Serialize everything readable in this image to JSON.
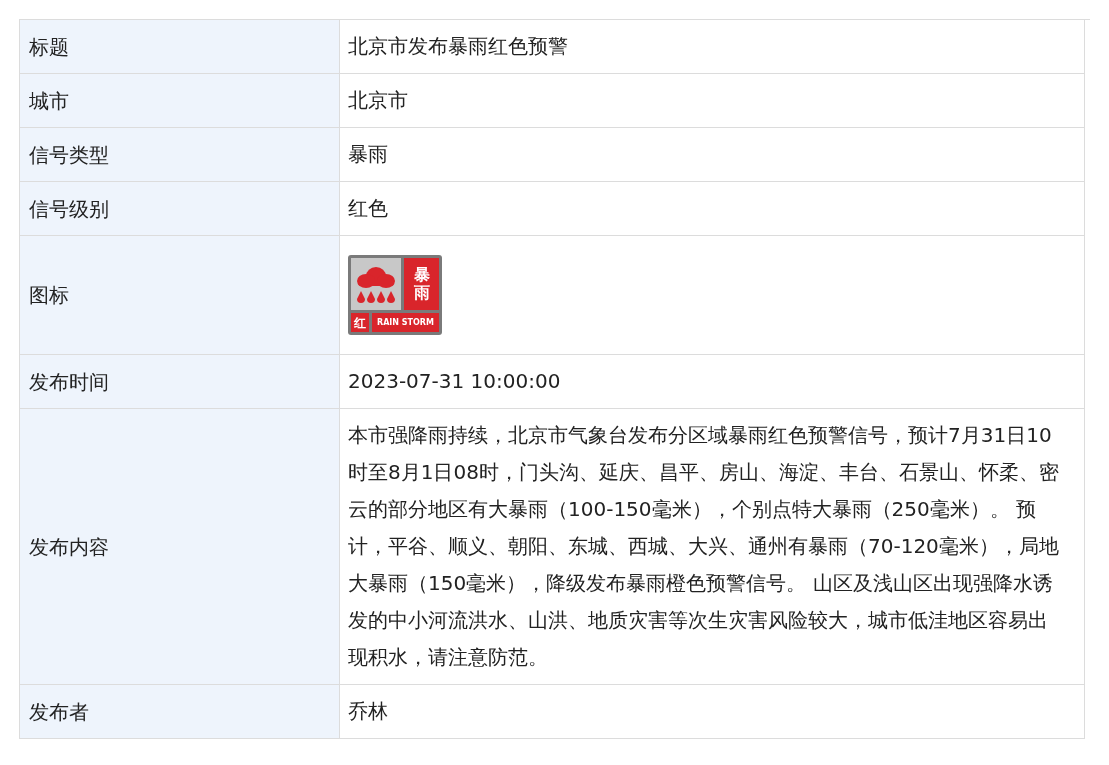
{
  "rows": [
    {
      "label": "标题",
      "kind": "text",
      "value": "北京市发布暴雨红色预警"
    },
    {
      "label": "城市",
      "kind": "text",
      "value": "北京市"
    },
    {
      "label": "信号类型",
      "kind": "text",
      "value": "暴雨"
    },
    {
      "label": "信号级别",
      "kind": "text",
      "value": "红色"
    },
    {
      "label": "图标",
      "kind": "icon",
      "icon": {
        "type_text": "暴雨",
        "level_text": "红",
        "english_text": "RAIN STORM"
      }
    },
    {
      "label": "发布时间",
      "kind": "text",
      "value": "2023-07-31 10:00:00"
    },
    {
      "label": "发布内容",
      "kind": "text",
      "value": "本市强降雨持续，北京市气象台发布分区域暴雨红色预警信号，预计7月31日10时至8月1日08时，门头沟、延庆、昌平、房山、海淀、丰台、石景山、怀柔、密云的部分地区有大暴雨（100-150毫米），个别点特大暴雨（250毫米）。 预计，平谷、顺义、朝阳、东城、西城、大兴、通州有暴雨（70-120毫米），局地大暴雨（150毫米），降级发布暴雨橙色预警信号。 山区及浅山区出现强降水诱发的中小河流洪水、山洪、地质灾害等次生灾害风险较大，城市低洼地区容易出现积水，请注意防范。"
    },
    {
      "label": "发布者",
      "kind": "text",
      "value": "乔林"
    }
  ]
}
